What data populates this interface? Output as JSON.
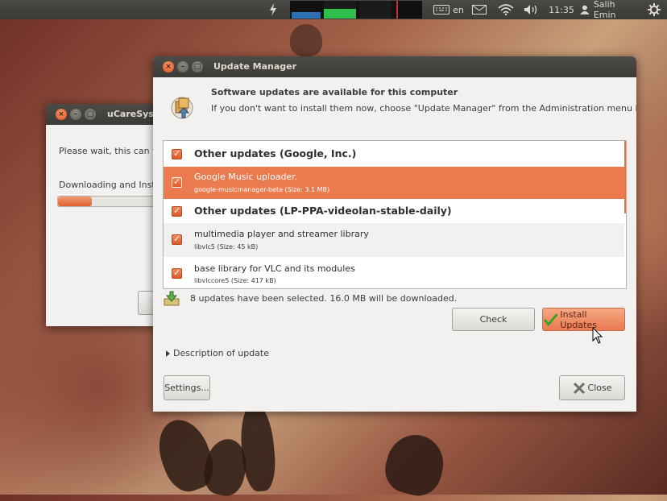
{
  "panel": {
    "keyboard_layout": "en",
    "clock": "11:35",
    "user_name": "Salih Emin"
  },
  "ucare_window": {
    "title": "uCareSyste",
    "message": "Please wait, this can ta",
    "status": "Downloading and Instal",
    "progress": 0.3
  },
  "update_manager": {
    "title": "Update Manager",
    "heading": "Software updates are available for this computer",
    "subheading": "If you don't want to install them now, choose \"Update Manager\" from the Administration menu later.",
    "groups": [
      {
        "label": "Other updates (Google, Inc.)",
        "items": [
          {
            "name": "Google Music uploader.",
            "detail": "google-musicmanager-beta (Size: 3.1 MB)",
            "selected": true
          }
        ]
      },
      {
        "label": "Other updates (LP-PPA-videolan-stable-daily)",
        "items": [
          {
            "name": "multimedia player and streamer library",
            "detail": "libvlc5 (Size: 45 kB)",
            "selected": false
          },
          {
            "name": "base library for VLC and its modules",
            "detail": "libvlccore5 (Size: 417 kB)",
            "selected": false
          }
        ]
      }
    ],
    "summary": "8 updates have been selected. 16.0 MB will be downloaded.",
    "check_label": "Check",
    "install_label": "Install Updates",
    "description_label": "Description of update",
    "settings_label": "Settings...",
    "close_label": "Close"
  },
  "colors": {
    "accent": "#e9774b",
    "selected_row": "#ec7a4f",
    "panel": "#3c3b37"
  }
}
